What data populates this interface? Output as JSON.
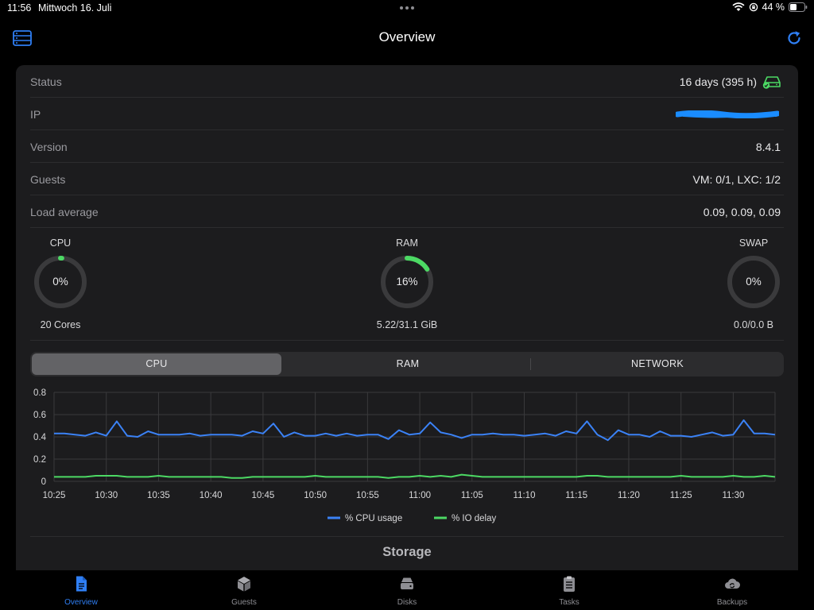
{
  "statusbar": {
    "time": "11:56",
    "date": "Mittwoch 16. Juli",
    "battery": "44 %"
  },
  "header": {
    "title": "Overview"
  },
  "info": {
    "status_label": "Status",
    "status_value": "16 days (395 h)",
    "ip_label": "IP",
    "version_label": "Version",
    "version_value": "8.4.1",
    "guests_label": "Guests",
    "guests_value": "VM: 0/1, LXC: 1/2",
    "load_label": "Load average",
    "load_value": "0.09, 0.09, 0.09"
  },
  "gauges": {
    "cpu": {
      "title": "CPU",
      "percent_label": "0%",
      "percent": 1,
      "sub": "20 Cores"
    },
    "ram": {
      "title": "RAM",
      "percent_label": "16%",
      "percent": 16,
      "sub": "5.22/31.1 GiB"
    },
    "swap": {
      "title": "SWAP",
      "percent_label": "0%",
      "percent": 0,
      "sub": "0.0/0.0 B"
    }
  },
  "segments": {
    "cpu": "CPU",
    "ram": "RAM",
    "network": "NETWORK",
    "selected": "CPU"
  },
  "chart_data": {
    "type": "line",
    "y_ticks": [
      "0",
      "0.2",
      "0.4",
      "0.6",
      "0.8"
    ],
    "ylim": [
      0,
      0.8
    ],
    "x_tick_labels": [
      "10:25",
      "10:30",
      "10:35",
      "10:40",
      "10:45",
      "10:50",
      "10:55",
      "11:00",
      "11:05",
      "11:10",
      "11:15",
      "11:20",
      "11:25",
      "11:30"
    ],
    "x_minutes_range": [
      "10:25",
      "11:34"
    ],
    "grid": true,
    "legend_placement": "bottom-center",
    "series": [
      {
        "name": "% CPU usage",
        "color": "#3b82f6",
        "values": [
          0.43,
          0.43,
          0.42,
          0.41,
          0.44,
          0.41,
          0.54,
          0.41,
          0.4,
          0.45,
          0.42,
          0.42,
          0.42,
          0.43,
          0.41,
          0.42,
          0.42,
          0.42,
          0.41,
          0.45,
          0.43,
          0.52,
          0.4,
          0.44,
          0.41,
          0.41,
          0.43,
          0.41,
          0.43,
          0.41,
          0.42,
          0.42,
          0.38,
          0.46,
          0.42,
          0.43,
          0.53,
          0.44,
          0.42,
          0.39,
          0.42,
          0.42,
          0.43,
          0.42,
          0.42,
          0.41,
          0.42,
          0.43,
          0.41,
          0.45,
          0.43,
          0.54,
          0.42,
          0.37,
          0.46,
          0.42,
          0.42,
          0.4,
          0.45,
          0.41,
          0.41,
          0.4,
          0.42,
          0.44,
          0.41,
          0.42,
          0.55,
          0.43,
          0.43,
          0.42
        ]
      },
      {
        "name": "% IO delay",
        "color": "#4cd964",
        "values": [
          0.04,
          0.04,
          0.04,
          0.04,
          0.05,
          0.05,
          0.05,
          0.04,
          0.04,
          0.04,
          0.05,
          0.04,
          0.04,
          0.04,
          0.04,
          0.04,
          0.04,
          0.03,
          0.03,
          0.04,
          0.04,
          0.04,
          0.04,
          0.04,
          0.04,
          0.05,
          0.04,
          0.04,
          0.04,
          0.04,
          0.04,
          0.04,
          0.03,
          0.04,
          0.04,
          0.05,
          0.04,
          0.05,
          0.04,
          0.06,
          0.05,
          0.04,
          0.04,
          0.04,
          0.04,
          0.04,
          0.04,
          0.04,
          0.04,
          0.04,
          0.04,
          0.05,
          0.05,
          0.04,
          0.04,
          0.04,
          0.04,
          0.04,
          0.04,
          0.04,
          0.05,
          0.04,
          0.04,
          0.04,
          0.04,
          0.05,
          0.04,
          0.04,
          0.05,
          0.04
        ]
      }
    ]
  },
  "storage": {
    "title": "Storage"
  },
  "tabs": [
    {
      "label": "Overview",
      "icon": "document-icon"
    },
    {
      "label": "Guests",
      "icon": "cube-icon"
    },
    {
      "label": "Disks",
      "icon": "disk-icon"
    },
    {
      "label": "Tasks",
      "icon": "clipboard-icon"
    },
    {
      "label": "Backups",
      "icon": "cloud-sync-icon"
    }
  ],
  "colors": {
    "accent": "#2f7ff5",
    "good": "#4cd964",
    "card_bg": "#1c1c1e"
  }
}
